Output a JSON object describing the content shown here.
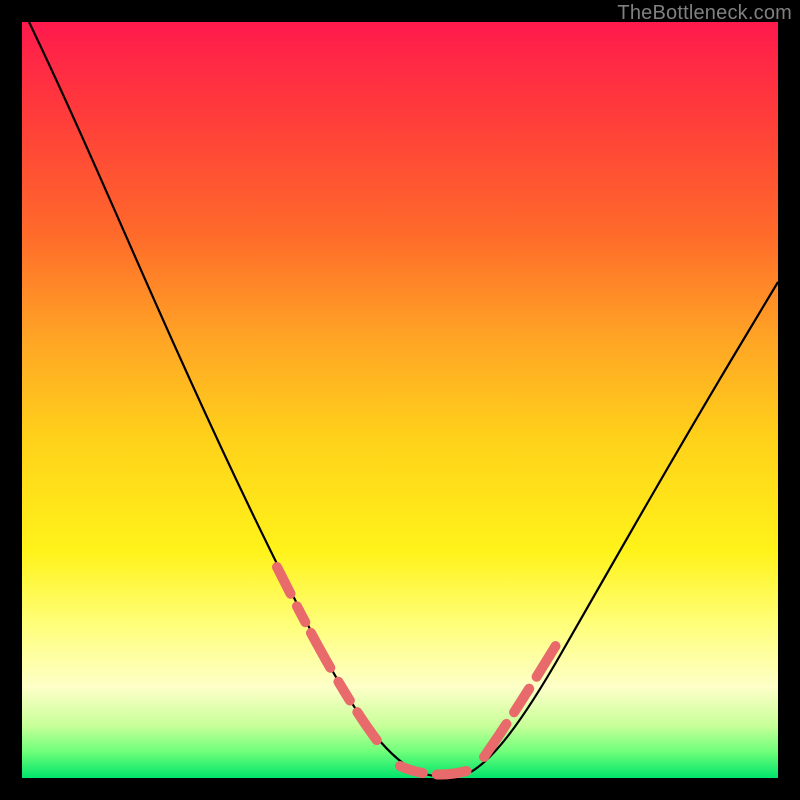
{
  "watermark": "TheBottleneck.com",
  "chart_data": {
    "type": "line",
    "title": "",
    "xlabel": "",
    "ylabel": "",
    "xlim": [
      0,
      100
    ],
    "ylim": [
      0,
      100
    ],
    "grid": false,
    "legend": false,
    "description": "V-shaped bottleneck curve over vertical rainbow gradient (red top → green bottom). Minimum of curve reaches y≈0 around x≈50–58. Secondary pink dashed overlay highlights lower portions of both arms near the valley.",
    "series": [
      {
        "name": "main-curve",
        "stroke": "#000000",
        "x": [
          1,
          5,
          10,
          15,
          20,
          25,
          30,
          35,
          40,
          45,
          48,
          50,
          53,
          56,
          58,
          60,
          65,
          70,
          75,
          80,
          85,
          90,
          95,
          99
        ],
        "y": [
          100,
          90,
          78,
          66,
          55,
          44,
          34,
          25,
          16,
          8,
          3,
          1,
          0,
          0,
          1,
          3,
          9,
          16,
          24,
          32,
          40,
          48,
          56,
          63
        ]
      },
      {
        "name": "highlight-dashes",
        "stroke": "#e86a6a",
        "style": "dashed",
        "segments": [
          {
            "x": [
              34,
              36,
              38,
              40,
              42,
              44,
              46,
              48
            ],
            "y": [
              27,
              23,
              19.5,
              16,
              13,
              10,
              6.5,
              3
            ]
          },
          {
            "x": [
              50,
              52,
              54,
              56,
              58
            ],
            "y": [
              1,
              0.3,
              0,
              0,
              1
            ]
          },
          {
            "x": [
              60,
              62,
              64,
              66,
              68,
              70
            ],
            "y": [
              3,
              5.5,
              8,
              10.5,
              13,
              16
            ]
          }
        ]
      }
    ]
  }
}
